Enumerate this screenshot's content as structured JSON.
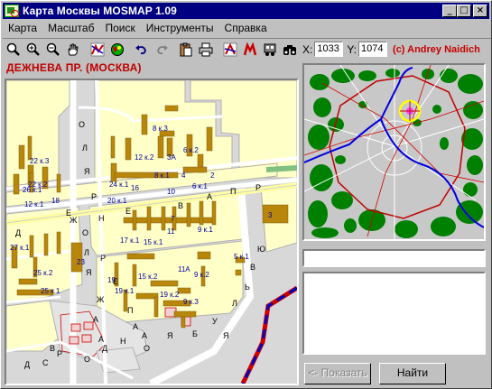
{
  "window": {
    "title": "Карта Москвы MOSMAP 1.09",
    "minimize_glyph": "_",
    "maximize_glyph": "□",
    "close_glyph": "×"
  },
  "menu": [
    "Карта",
    "Масштаб",
    "Поиск",
    "Инструменты",
    "Справка"
  ],
  "toolbar": {
    "tools": [
      "zoom-icon",
      "zoom-in-icon",
      "zoom-out-icon",
      "hand-icon",
      "route-icon",
      "globe-icon",
      "undo-icon",
      "redo-icon",
      "clipboard-icon",
      "print-icon",
      "layers-icon",
      "metro-icon",
      "transit-icon",
      "binoculars-icon"
    ],
    "x_label": "X:",
    "x_value": "1033",
    "y_label": "Y:",
    "y_value": "1074",
    "copyright": "(c) Andrey Naidich"
  },
  "street_name": "ДЕЖНЕВА ПР. (МОСКВА)",
  "map": {
    "street_letters": [
      "О",
      "Л",
      "Я",
      "Р",
      "Д",
      "Е",
      "Ж",
      "Н",
      "Е",
      "В",
      "А",
      "П",
      "Р",
      "О",
      "Л",
      "Я",
      "Р",
      "Ж",
      "А",
      "Е",
      "О",
      "Д",
      "Н",
      "А",
      "Я",
      "Б",
      "У",
      "Л",
      "Ь",
      "В",
      "А",
      "Р",
      "С",
      "Д",
      "В",
      "О",
      "А",
      "П",
      "Я",
      "Ю"
    ],
    "house_numbers": [
      "8 к.3",
      "6 к.2",
      "12 к.2",
      "3А",
      "22 к.3",
      "2",
      "4",
      "22 к.2",
      "10",
      "8 к.1",
      "6 к.1",
      "26 к.1",
      "16",
      "12 к.1",
      "24 к.1",
      "18",
      "20 к.1",
      "3",
      "7",
      "9 к.1",
      "27 к.1",
      "17 к.1",
      "15 к.1",
      "11",
      "23",
      "5 к.1",
      "25 к.2",
      "19",
      "15 к.2",
      "11А",
      "9 к.2",
      "25 к.1",
      "19 к.1",
      "19 к.2",
      "9 к.3"
    ]
  },
  "overview_marker_color": "#ffff00",
  "colors": {
    "title_bar": "#000080",
    "copyright": "#c80000",
    "street": "#c00000",
    "building": "#b8860b",
    "parks": "#008000"
  },
  "buttons": {
    "show": "<- Показать",
    "find": "Найти"
  },
  "search_value": ""
}
